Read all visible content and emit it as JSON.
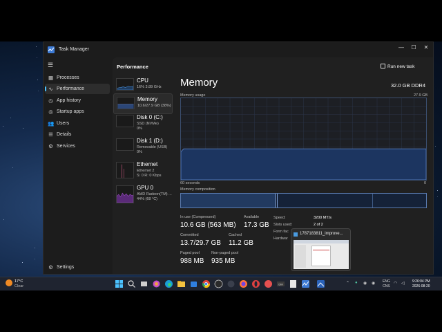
{
  "window": {
    "title": "Task Manager",
    "controls": {
      "minimize": "—",
      "maximize": "☐",
      "close": "✕"
    }
  },
  "sidebar": {
    "items": [
      {
        "label": "Processes",
        "icon": "processes-icon"
      },
      {
        "label": "Performance",
        "icon": "performance-icon",
        "active": true
      },
      {
        "label": "App history",
        "icon": "history-icon"
      },
      {
        "label": "Startup apps",
        "icon": "startup-icon"
      },
      {
        "label": "Users",
        "icon": "users-icon"
      },
      {
        "label": "Details",
        "icon": "details-icon"
      },
      {
        "label": "Services",
        "icon": "services-icon"
      }
    ],
    "settings_label": "Settings"
  },
  "header": {
    "title": "Performance",
    "run_task_label": "Run new task"
  },
  "perf_list": [
    {
      "name": "CPU",
      "sub1": "16% 3.89 GHz",
      "sub2": "",
      "color": "#4a90d9"
    },
    {
      "name": "Memory",
      "sub1": "10.6/27.9 GB (38%)",
      "sub2": "",
      "color": "#6a8fd4",
      "selected": true
    },
    {
      "name": "Disk 0 (C:)",
      "sub1": "SSD (NVMe)",
      "sub2": "0%",
      "color": "#5aa05a"
    },
    {
      "name": "Disk 1 (D:)",
      "sub1": "Removable (USB)",
      "sub2": "0%",
      "color": "#5aa05a"
    },
    {
      "name": "Ethernet",
      "sub1": "Ethernet 2",
      "sub2": "S: 0 R: 0 Kbps",
      "color": "#c0587a"
    },
    {
      "name": "GPU 0",
      "sub1": "AMD Radeon(TM) ...",
      "sub2": "44% (68 °C)",
      "color": "#a050c8"
    }
  ],
  "memory": {
    "title": "Memory",
    "total": "32.0 GB DDR4",
    "usage_label": "Memory usage",
    "max_label": "27.9 GB",
    "seconds_label": "60 seconds",
    "zero_label": "0",
    "composition_label": "Memory composition",
    "usage_fraction": 0.38,
    "stats": {
      "in_use_label": "In use (Compressed)",
      "in_use": "10.6 GB (563 MB)",
      "available_label": "Available",
      "available": "17.3 GB",
      "committed_label": "Committed",
      "committed": "13.7/29.7 GB",
      "cached_label": "Cached",
      "cached": "11.2 GB",
      "paged_label": "Paged pool",
      "paged": "988 MB",
      "nonpaged_label": "Non-paged pool",
      "nonpaged": "935 MB"
    },
    "details": {
      "speed_label": "Speed:",
      "speed": "3200 MT/s",
      "slots_label": "Slots used:",
      "slots": "2 of 2",
      "form_label": "Form fac",
      "hw_label": "Hardwar"
    }
  },
  "popup": {
    "title": "1787183811_improve..."
  },
  "taskbar": {
    "weather_temp": "17°C",
    "weather_desc": "Clear",
    "lang1": "ENG",
    "lang2": "CNS",
    "time": "9:26:04 PM",
    "date": "2026-08-20"
  }
}
